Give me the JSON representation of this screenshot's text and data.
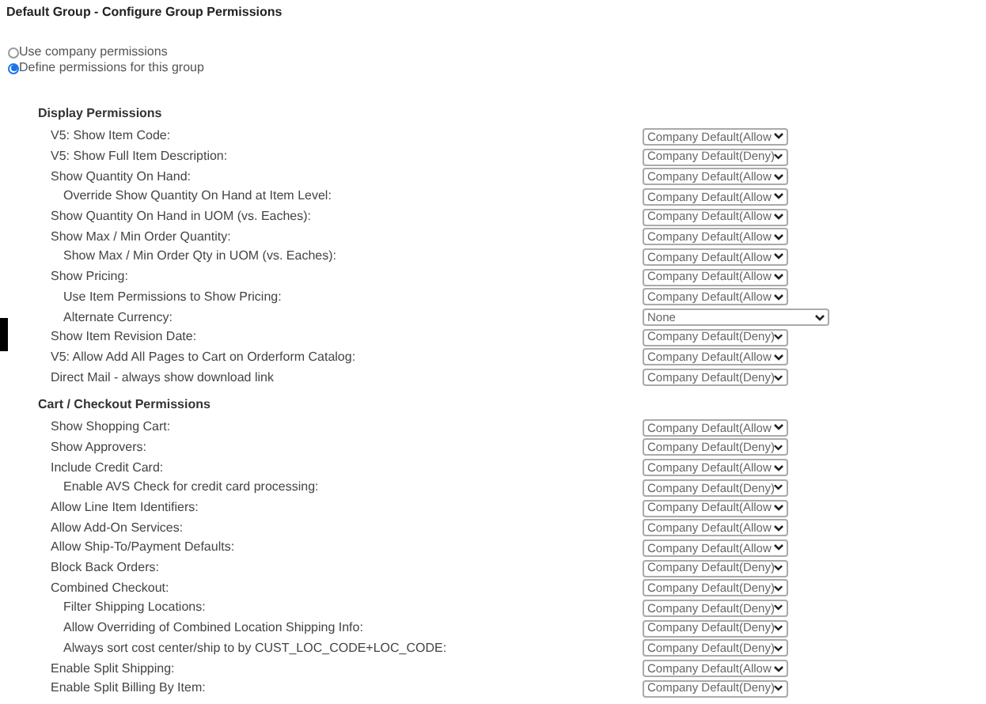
{
  "title": "Default Group - Configure Group Permissions",
  "mode_options": [
    {
      "label": "Use company permissions",
      "selected": false
    },
    {
      "label": "Define permissions for this group",
      "selected": true
    }
  ],
  "sections": [
    {
      "heading": "Display Permissions",
      "rows": [
        {
          "label": "V5: Show Item Code:",
          "value": "Company Default(Allow"
        },
        {
          "label": "V5: Show Full Item Description:",
          "value": "Company Default(Deny)"
        },
        {
          "label": "Show Quantity On Hand:",
          "value": "Company Default(Allow",
          "children": [
            {
              "label": "Override Show Quantity On Hand at Item Level:",
              "value": "Company Default(Allow"
            }
          ]
        },
        {
          "label": "Show Quantity On Hand in UOM (vs. Eaches):",
          "value": "Company Default(Allow"
        },
        {
          "label": "Show Max / Min Order Quantity:",
          "value": "Company Default(Allow",
          "children": [
            {
              "label": "Show Max / Min Order Qty in UOM (vs. Eaches):",
              "value": "Company Default(Allow"
            }
          ]
        },
        {
          "label": "Show Pricing:",
          "value": "Company Default(Allow",
          "children": [
            {
              "label": "Use Item Permissions to Show Pricing:",
              "value": "Company Default(Allow"
            },
            {
              "label": "Alternate Currency:",
              "value": "None",
              "kind": "wide"
            }
          ]
        },
        {
          "label": "Show Item Revision Date:",
          "value": "Company Default(Deny)"
        },
        {
          "label": "V5: Allow Add All Pages to Cart on Orderform Catalog:",
          "value": "Company Default(Allow"
        },
        {
          "label": "Direct Mail - always show download link",
          "value": "Company Default(Deny)"
        }
      ]
    },
    {
      "heading": "Cart / Checkout Permissions",
      "rows": [
        {
          "label": "Show Shopping Cart:",
          "value": "Company Default(Allow"
        },
        {
          "label": "Show Approvers:",
          "value": "Company Default(Deny)"
        },
        {
          "label": "Include Credit Card:",
          "value": "Company Default(Allow",
          "children": [
            {
              "label": "Enable AVS Check for credit card processing:",
              "value": "Company Default(Deny)"
            }
          ]
        },
        {
          "label": "Allow Line Item Identifiers:",
          "value": "Company Default(Allow"
        },
        {
          "label": "Allow Add-On Services:",
          "value": "Company Default(Allow"
        },
        {
          "label": "Allow Ship-To/Payment Defaults:",
          "value": "Company Default(Allow"
        },
        {
          "label": "Block Back Orders:",
          "value": "Company Default(Deny)"
        },
        {
          "label": "Combined Checkout:",
          "value": "Company Default(Deny)",
          "children": [
            {
              "label": "Filter Shipping Locations:",
              "value": "Company Default(Deny)"
            },
            {
              "label": "Allow Overriding of Combined Location Shipping Info:",
              "value": "Company Default(Deny)"
            },
            {
              "label": "Always sort cost center/ship to by CUST_LOC_CODE+LOC_CODE:",
              "value": "Company Default(Deny)"
            }
          ]
        },
        {
          "label": "Enable Split Shipping:",
          "value": "Company Default(Allow"
        },
        {
          "label": "Enable Split Billing By Item:",
          "value": "Company Default(Deny)"
        }
      ]
    }
  ]
}
